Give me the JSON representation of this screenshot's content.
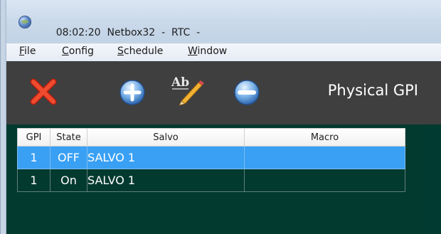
{
  "window": {
    "time": "08:02:20",
    "title": "Netbox32  -  RTC  -"
  },
  "menu": [
    {
      "access": "F",
      "rest": "ile"
    },
    {
      "access": "C",
      "rest": "onfig"
    },
    {
      "access": "S",
      "rest": "chedule"
    },
    {
      "access": "W",
      "rest": "indow"
    }
  ],
  "toolbar": {
    "title": "Physical GPI"
  },
  "table": {
    "headers": [
      "GPI",
      "State",
      "Salvo",
      "Macro"
    ],
    "rows": [
      {
        "gpi": "1",
        "state": "OFF",
        "salvo": "SALVO 1",
        "macro": ""
      },
      {
        "gpi": "1",
        "state": "On",
        "salvo": "SALVO 1",
        "macro": ""
      }
    ]
  },
  "colors": {
    "toolbar_bg": "#3f3f3f",
    "content_bg": "#033a30",
    "selected_row": "#39a0f4"
  },
  "icons": [
    "app-globe-icon",
    "close-x-icon",
    "add-plus-icon",
    "rename-ab-pencil-icon",
    "remove-minus-icon"
  ]
}
